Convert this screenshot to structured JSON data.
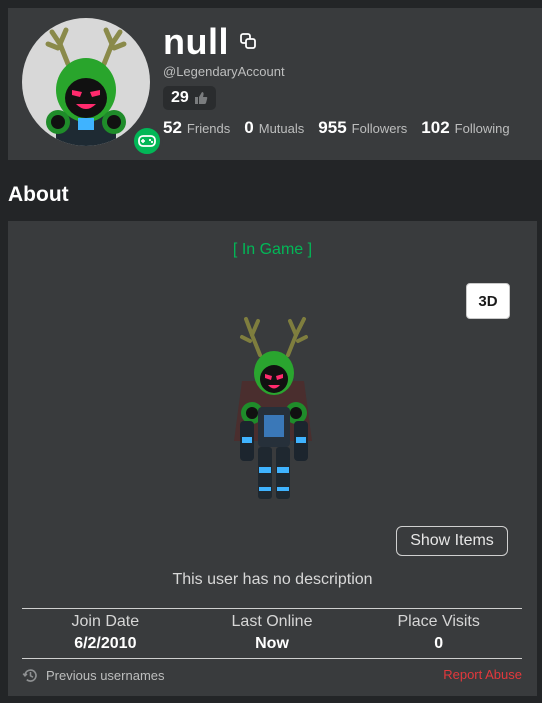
{
  "profile": {
    "display_name": "null",
    "username": "@LegendaryAccount",
    "likes": "29",
    "presence_icon": "gamepad-icon",
    "stats": [
      {
        "value": "52",
        "label": "Friends"
      },
      {
        "value": "0",
        "label": "Mutuals"
      },
      {
        "value": "955",
        "label": "Followers"
      },
      {
        "value": "102",
        "label": "Following"
      }
    ]
  },
  "about": {
    "heading": "About",
    "status": "[ In Game ]",
    "view_toggle": "3D",
    "show_items": "Show Items",
    "description": "This user has no description",
    "join_date_label": "Join Date",
    "join_date_value": "6/2/2010",
    "last_online_label": "Last Online",
    "last_online_value": "Now",
    "place_visits_label": "Place Visits",
    "place_visits_value": "0",
    "previous_usernames": "Previous usernames",
    "report_abuse": "Report Abuse"
  },
  "colors": {
    "background": "#232527",
    "card": "#393b3d",
    "presence_green": "#02b757",
    "report_red": "#e2383c"
  }
}
